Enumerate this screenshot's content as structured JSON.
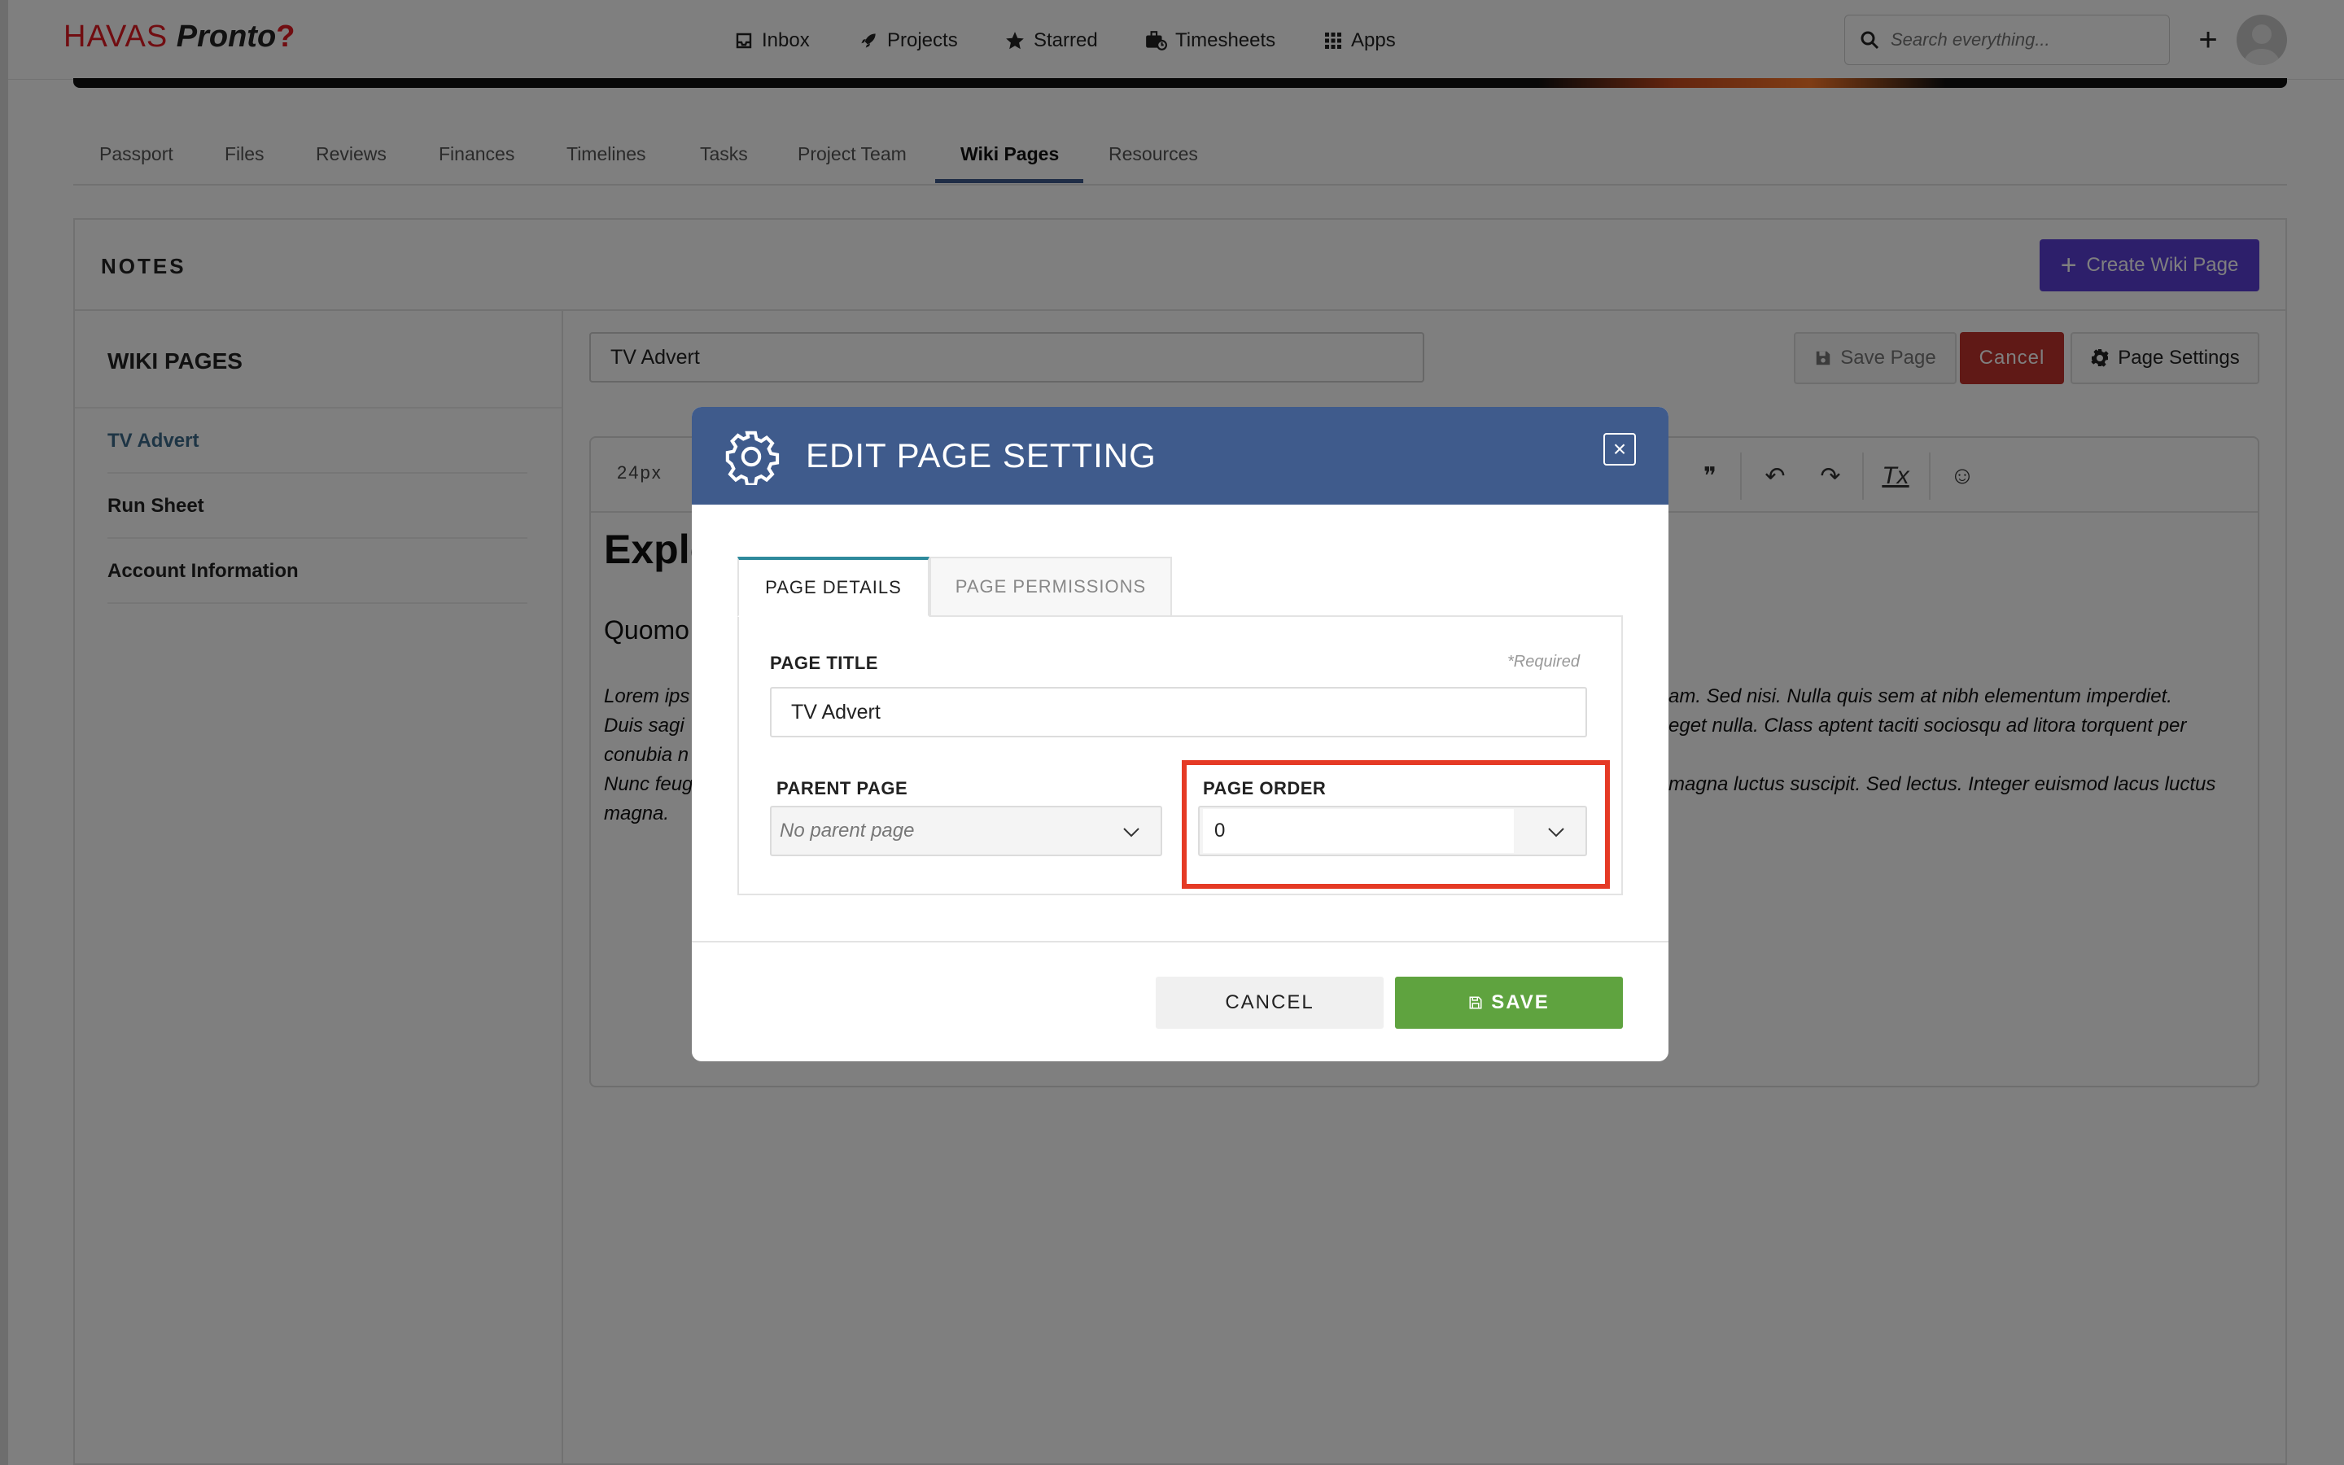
{
  "topnav": {
    "logo_havas": "HAVAS",
    "logo_pronto": "Pronto",
    "logo_bolt": "?",
    "items": [
      {
        "label": "Inbox",
        "icon": "inbox-icon"
      },
      {
        "label": "Projects",
        "icon": "rocket-icon"
      },
      {
        "label": "Starred",
        "icon": "star-icon"
      },
      {
        "label": "Timesheets",
        "icon": "timesheet-icon"
      },
      {
        "label": "Apps",
        "icon": "grid-icon"
      }
    ],
    "search_placeholder": "Search everything...",
    "plus_label": "+"
  },
  "tabs": [
    "Passport",
    "Files",
    "Reviews",
    "Finances",
    "Timelines",
    "Tasks",
    "Project Team",
    "Wiki Pages",
    "Resources"
  ],
  "active_tab": "Wiki Pages",
  "notes": {
    "title": "NOTES",
    "create_button": "Create Wiki Page",
    "create_icon": "+"
  },
  "sidebar": {
    "heading": "WIKI PAGES",
    "items": [
      "TV Advert",
      "Run Sheet",
      "Account Information"
    ]
  },
  "editor": {
    "title_value": "TV Advert",
    "save_page": "Save Page",
    "cancel": "Cancel",
    "page_settings": "Page Settings",
    "font_size": "24px",
    "toolbar_quote": "❞",
    "toolbar_undo": "↶",
    "toolbar_redo": "↷",
    "toolbar_clear": "Tx",
    "toolbar_emoji": "☺",
    "heading_partial": "Explo",
    "subheading_partial": "Quomo",
    "left_lines": [
      "Lorem ips",
      "Duis sagi",
      "conubia n",
      "Nunc feug",
      "magna."
    ],
    "right_lines": [
      "am. Sed nisi. Nulla quis sem at nibh elementum imperdiet.",
      "eget nulla. Class aptent taciti sociosqu ad litora torquent per",
      "magna luctus suscipit. Sed lectus. Integer euismod lacus luctus"
    ]
  },
  "modal": {
    "title": "EDIT PAGE SETTING",
    "close": "×",
    "tab_details": "PAGE DETAILS",
    "tab_permissions": "PAGE PERMISSIONS",
    "page_title_label": "PAGE TITLE",
    "required": "*Required",
    "page_title_value": "TV Advert",
    "parent_label": "PARENT PAGE",
    "parent_value": "No parent page",
    "order_label": "PAGE ORDER",
    "order_value": "0",
    "cancel": "CANCEL",
    "save": "SAVE"
  },
  "colors": {
    "modal_header": "#3f5b8c",
    "save_green": "#5fa33f",
    "cancel_red": "#c0322c",
    "create_purple": "#5b3fd6",
    "highlight_red": "#e53a25"
  }
}
